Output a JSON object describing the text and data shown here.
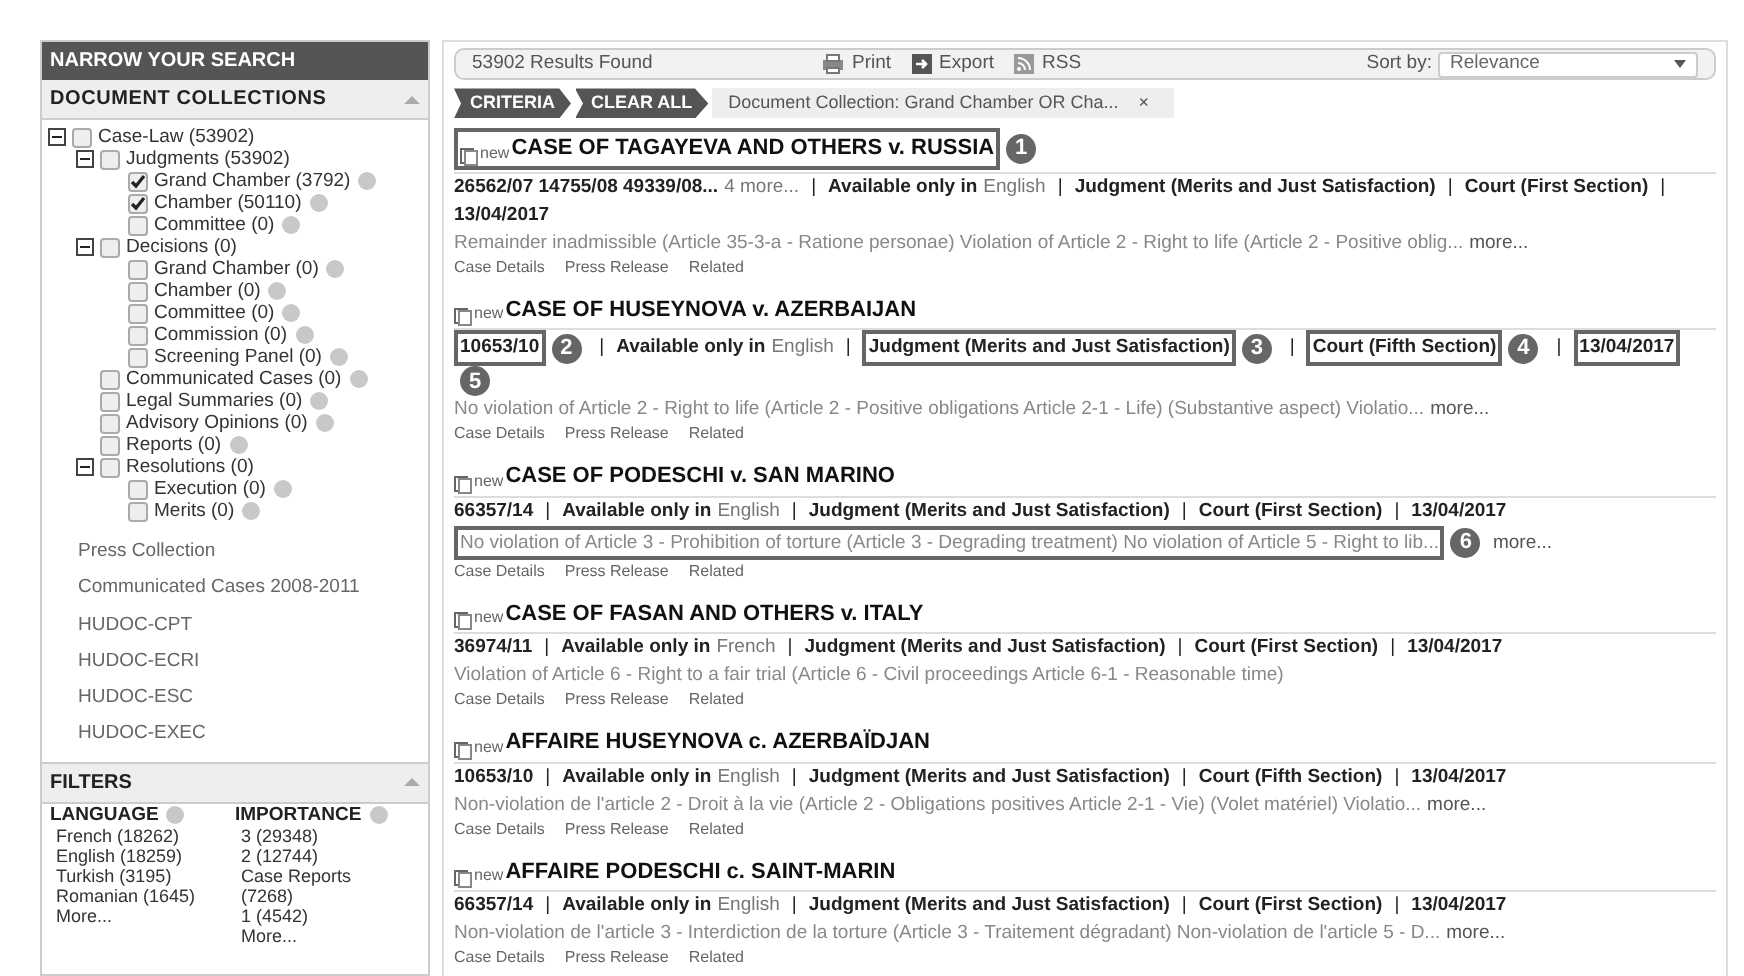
{
  "sidebar": {
    "title": "NARROW YOUR SEARCH",
    "collections": {
      "heading": "DOCUMENT COLLECTIONS",
      "expanded": true,
      "tree": [
        {
          "label": "Case-Law (53902)",
          "checked": false,
          "help": false,
          "expanded": true,
          "children": [
            {
              "label": "Judgments (53902)",
              "checked": false,
              "help": false,
              "expanded": true,
              "children": [
                {
                  "label": "Grand Chamber (3792)",
                  "checked": true,
                  "help": true
                },
                {
                  "label": "Chamber (50110)",
                  "checked": true,
                  "help": true
                },
                {
                  "label": "Committee (0)",
                  "checked": false,
                  "help": true
                }
              ]
            },
            {
              "label": "Decisions (0)",
              "checked": false,
              "help": false,
              "expanded": true,
              "children": [
                {
                  "label": "Grand Chamber (0)",
                  "checked": false,
                  "help": true
                },
                {
                  "label": "Chamber (0)",
                  "checked": false,
                  "help": true
                },
                {
                  "label": "Committee (0)",
                  "checked": false,
                  "help": true
                },
                {
                  "label": "Commission (0)",
                  "checked": false,
                  "help": true
                },
                {
                  "label": "Screening Panel (0)",
                  "checked": false,
                  "help": true
                }
              ]
            },
            {
              "label": "Communicated Cases (0)",
              "checked": false,
              "help": true
            },
            {
              "label": "Legal Summaries (0)",
              "checked": false,
              "help": true
            },
            {
              "label": "Advisory Opinions (0)",
              "checked": false,
              "help": true
            },
            {
              "label": "Reports (0)",
              "checked": false,
              "help": true
            },
            {
              "label": "Resolutions (0)",
              "checked": false,
              "help": false,
              "expanded": true,
              "children": [
                {
                  "label": "Execution (0)",
                  "checked": false,
                  "help": true
                },
                {
                  "label": "Merits (0)",
                  "checked": false,
                  "help": true
                }
              ]
            }
          ]
        }
      ]
    },
    "links": [
      "Press Collection",
      "Communicated Cases 2008-2011",
      "HUDOC-CPT",
      "HUDOC-ECRI",
      "HUDOC-ESC",
      "HUDOC-EXEC"
    ],
    "filters": {
      "heading": "FILTERS",
      "expanded": true,
      "groups": [
        {
          "title": "LANGUAGE",
          "items": [
            "French (18262)",
            "English (18259)",
            "Turkish (3195)",
            "Romanian (1645)"
          ],
          "more": "More..."
        },
        {
          "title": "IMPORTANCE",
          "items": [
            "3 (29348)",
            "2 (12744)",
            "Case Reports (7268)",
            "1 (4542)"
          ],
          "more": "More..."
        }
      ]
    }
  },
  "toolbar": {
    "count": "53902 Results Found",
    "actions": [
      {
        "label": "Print",
        "kind": "print"
      },
      {
        "label": "Export",
        "kind": "export"
      },
      {
        "label": "RSS",
        "kind": "rss"
      }
    ],
    "sort_label": "Sort by:",
    "sort_value": "Relevance"
  },
  "criteria": {
    "crumbs": [
      "CRITERIA",
      "CLEAR ALL"
    ],
    "chip": "Document Collection: Grand Chamber OR Cha...",
    "remove": "×"
  },
  "results": [
    {
      "badge": "new",
      "title": "CASE OF TAGAYEVA AND OTHERS v. RUSSIA",
      "separator": "|",
      "appno": "26562/07 14755/08 49339/08...",
      "appno_more": "4 more...",
      "available": "Available only in",
      "language": "English",
      "judgment": "Judgment (Merits and Just Satisfaction)",
      "court": "Court (First Section)",
      "date": "13/04/2017",
      "summary": "Remainder inadmissible (Article 35-3-a - Ratione personae) Violation of Article 2 - Right to life (Article 2 - Positive oblig...",
      "more": "more...",
      "links": [
        "Case Details",
        "Press Release",
        "Related"
      ],
      "callouts": {
        "title": "1"
      }
    },
    {
      "badge": "new",
      "title": "CASE OF HUSEYNOVA v. AZERBAIJAN",
      "separator": "|",
      "appno": "10653/10",
      "available": "Available only in",
      "language": "English",
      "judgment": "Judgment (Merits and Just Satisfaction)",
      "court": "Court (Fifth Section)",
      "date": "13/04/2017",
      "summary": "No violation of Article 2 - Right to life (Article 2 - Positive obligations Article 2-1 - Life) (Substantive aspect) Violatio...",
      "more": "more...",
      "links": [
        "Case Details",
        "Press Release",
        "Related"
      ],
      "callouts": {
        "appno": "2",
        "judgment": "3",
        "court": "4",
        "date": "5"
      }
    },
    {
      "badge": "new",
      "title": "CASE OF PODESCHI v. SAN MARINO",
      "separator": "|",
      "appno": "66357/14",
      "available": "Available only in",
      "language": "English",
      "judgment": "Judgment (Merits and Just Satisfaction)",
      "court": "Court (First Section)",
      "date": "13/04/2017",
      "summary": "No violation of Article 3 - Prohibition of torture (Article 3 - Degrading treatment) No violation of Article 5 - Right to lib...",
      "more": "more...",
      "links": [
        "Case Details",
        "Press Release",
        "Related"
      ],
      "callouts": {
        "summary": "6"
      }
    },
    {
      "badge": "new",
      "title": "CASE OF FASAN AND OTHERS v. ITALY",
      "separator": "|",
      "appno": "36974/11",
      "available": "Available only in",
      "language": "French",
      "judgment": "Judgment (Merits and Just Satisfaction)",
      "court": "Court (First Section)",
      "date": "13/04/2017",
      "summary": "Violation of Article 6 - Right to a fair trial (Article 6 - Civil proceedings Article 6-1 - Reasonable time)",
      "links": [
        "Case Details",
        "Press Release",
        "Related"
      ]
    },
    {
      "badge": "new",
      "title": "AFFAIRE HUSEYNOVA c. AZERBAÏDJAN",
      "separator": "|",
      "appno": "10653/10",
      "available": "Available only in",
      "language": "English",
      "judgment": "Judgment (Merits and Just Satisfaction)",
      "court": "Court (Fifth Section)",
      "date": "13/04/2017",
      "summary": "Non-violation de l'article 2 - Droit à la vie (Article 2 - Obligations positives Article 2-1 - Vie) (Volet matériel) Violatio...",
      "more": "more...",
      "links": [
        "Case Details",
        "Press Release",
        "Related"
      ]
    },
    {
      "badge": "new",
      "title": "AFFAIRE PODESCHI c. SAINT-MARIN",
      "separator": "|",
      "appno": "66357/14",
      "available": "Available only in",
      "language": "English",
      "judgment": "Judgment (Merits and Just Satisfaction)",
      "court": "Court (First Section)",
      "date": "13/04/2017",
      "summary": "Non-violation de l'article 3 - Interdiction de la torture (Article 3 - Traitement dégradant) Non-violation de l'article 5 - D...",
      "more": "more...",
      "links": [
        "Case Details",
        "Press Release",
        "Related"
      ]
    }
  ]
}
